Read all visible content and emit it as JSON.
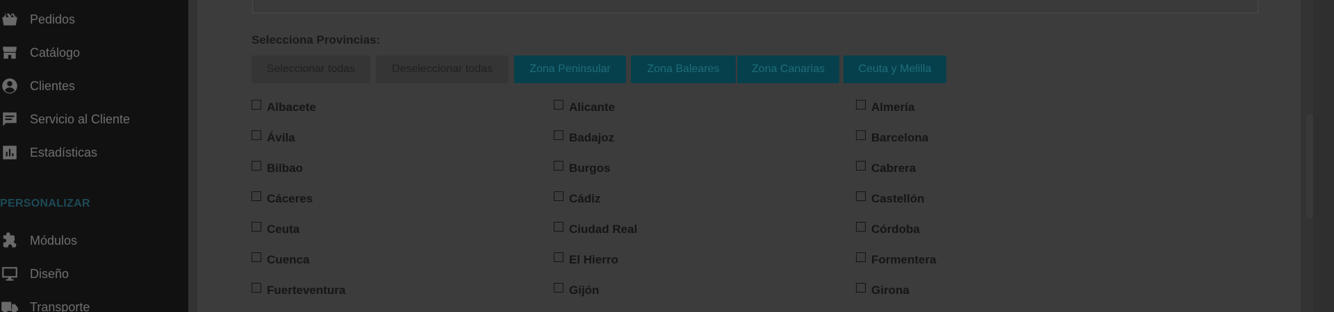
{
  "sidebar": {
    "items": [
      {
        "label": "Pedidos",
        "icon": "basket-icon"
      },
      {
        "label": "Catálogo",
        "icon": "store-icon"
      },
      {
        "label": "Clientes",
        "icon": "user-circle-icon"
      },
      {
        "label": "Servicio al Cliente",
        "icon": "chat-icon"
      },
      {
        "label": "Estadísticas",
        "icon": "bar-chart-icon"
      }
    ],
    "section_title": "PERSONALIZAR",
    "section_items": [
      {
        "label": "Módulos",
        "icon": "puzzle-icon"
      },
      {
        "label": "Diseño",
        "icon": "monitor-icon"
      },
      {
        "label": "Transporte",
        "icon": "truck-icon"
      }
    ]
  },
  "provinces_form": {
    "title": "Selecciona Provincias:",
    "buttons": {
      "select_all": "Seleccionar todas",
      "deselect_all": "Deseleccionar todas",
      "zona_peninsular": "Zona Peninsular",
      "zona_baleares": "Zona Baleares",
      "zona_canarias": "Zona Canarias",
      "ceuta_melilla": "Ceuta y Melilla"
    },
    "provinces": [
      [
        "Albacete",
        "Alicante",
        "Almería"
      ],
      [
        "Ávila",
        "Badajoz",
        "Barcelona"
      ],
      [
        "Bilbao",
        "Burgos",
        "Cabrera"
      ],
      [
        "Cáceres",
        "Cádiz",
        "Castellón"
      ],
      [
        "Ceuta",
        "Ciudad Real",
        "Córdoba"
      ],
      [
        "Cuenca",
        "El Hierro",
        "Formentera"
      ],
      [
        "Fuerteventura",
        "Gijón",
        "Girona"
      ]
    ]
  },
  "colors": {
    "sidebar_bg": "#111111",
    "page_bg": "#3c3c3c",
    "teal_button": "#06404d",
    "teal_text": "#1f6d7a"
  }
}
